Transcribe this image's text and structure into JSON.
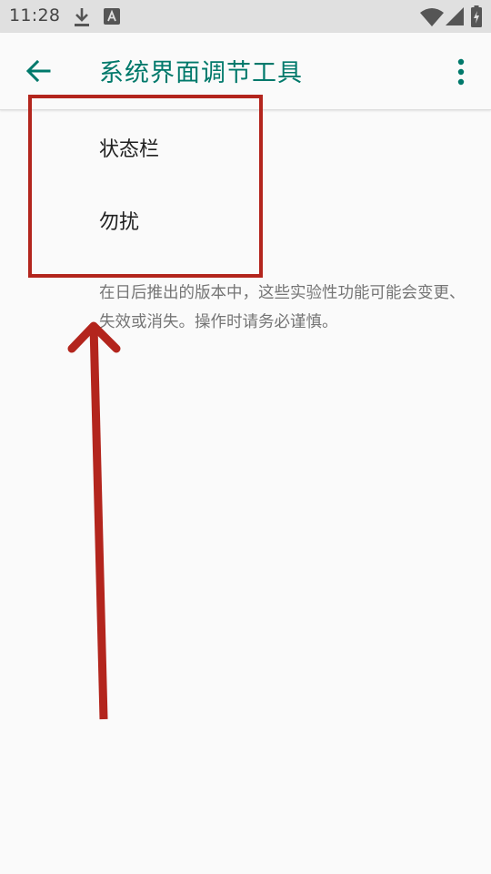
{
  "status_bar": {
    "time": "11:28",
    "icons": [
      "download-icon",
      "text-a-icon",
      "wifi-icon",
      "signal-icon",
      "battery-charging-icon"
    ]
  },
  "app_bar": {
    "title": "系统界面调节工具",
    "back_icon": "arrow-back-icon",
    "overflow_icon": "more-vert-icon",
    "accent_color": "#00796b"
  },
  "menu": {
    "items": [
      {
        "label": "状态栏"
      },
      {
        "label": "勿扰"
      }
    ]
  },
  "footer": {
    "text": "在日后推出的版本中，这些实验性功能可能会变更、失效或消失。操作时请务必谨慎。"
  },
  "annotation": {
    "color": "#b3251d"
  }
}
